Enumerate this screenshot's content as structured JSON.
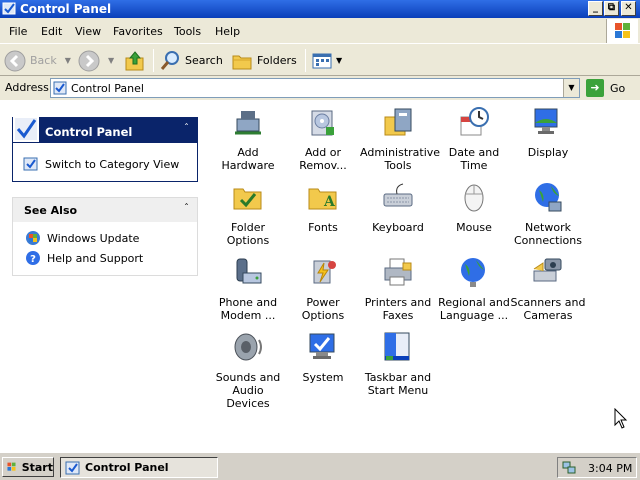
{
  "window": {
    "title": "Control Panel",
    "controls": [
      "minimize",
      "restore",
      "close"
    ]
  },
  "menu": [
    "File",
    "Edit",
    "View",
    "Favorites",
    "Tools",
    "Help"
  ],
  "toolbar": {
    "back_label": "Back",
    "search_label": "Search",
    "folders_label": "Folders"
  },
  "address": {
    "label": "Address",
    "value": "Control Panel",
    "go_label": "Go"
  },
  "left_pane": {
    "control_panel": {
      "title": "Control Panel",
      "link": "Switch to Category View"
    },
    "see_also": {
      "title": "See Also",
      "items": [
        "Windows Update",
        "Help and Support"
      ]
    }
  },
  "icons": [
    {
      "line1": "Add Hardware",
      "line2": "",
      "icon": "add-hardware-icon"
    },
    {
      "line1": "Add or",
      "line2": "Remov...",
      "icon": "add-remove-programs-icon"
    },
    {
      "line1": "Administrative",
      "line2": "Tools",
      "icon": "administrative-tools-icon"
    },
    {
      "line1": "Date and Time",
      "line2": "",
      "icon": "date-time-icon"
    },
    {
      "line1": "Display",
      "line2": "",
      "icon": "display-icon"
    },
    {
      "line1": "Folder Options",
      "line2": "",
      "icon": "folder-options-icon"
    },
    {
      "line1": "Fonts",
      "line2": "",
      "icon": "fonts-icon"
    },
    {
      "line1": "Keyboard",
      "line2": "",
      "icon": "keyboard-icon"
    },
    {
      "line1": "Mouse",
      "line2": "",
      "icon": "mouse-icon"
    },
    {
      "line1": "Network",
      "line2": "Connections",
      "icon": "network-connections-icon"
    },
    {
      "line1": "Phone and",
      "line2": "Modem ...",
      "icon": "phone-modem-icon"
    },
    {
      "line1": "Power Options",
      "line2": "",
      "icon": "power-options-icon"
    },
    {
      "line1": "Printers and",
      "line2": "Faxes",
      "icon": "printers-faxes-icon"
    },
    {
      "line1": "Regional and",
      "line2": "Language ...",
      "icon": "regional-language-icon"
    },
    {
      "line1": "Scanners and",
      "line2": "Cameras",
      "icon": "scanners-cameras-icon"
    },
    {
      "line1": "Sounds and",
      "line2": "Audio Devices",
      "icon": "sounds-audio-icon"
    },
    {
      "line1": "System",
      "line2": "",
      "icon": "system-icon"
    },
    {
      "line1": "Taskbar and",
      "line2": "Start Menu",
      "icon": "taskbar-start-menu-icon"
    }
  ],
  "taskbar": {
    "start_label": "Start",
    "task_label": "Control Panel",
    "clock": "3:04 PM"
  }
}
